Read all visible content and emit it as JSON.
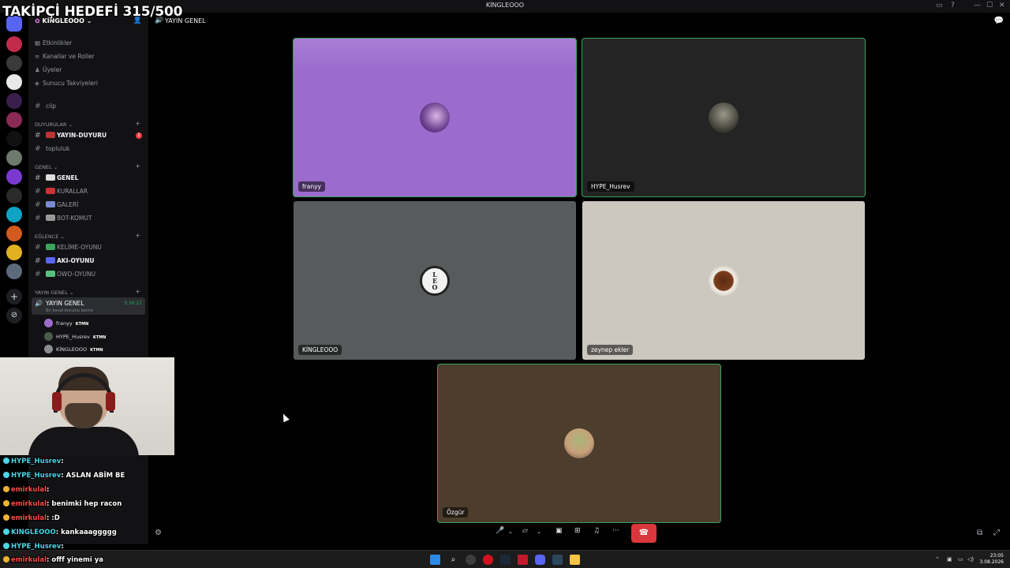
{
  "overlay": {
    "follower_goal": "TAKİPÇİ HEDEFİ 315/500"
  },
  "window": {
    "title": "KİNGLEOOO"
  },
  "server": {
    "name": "KİNGLEOOO"
  },
  "sidebar": {
    "menu": [
      {
        "label": "Etkinlikler",
        "icon": "calendar-icon"
      },
      {
        "label": "Kanallar ve Roller",
        "icon": "channels-icon"
      },
      {
        "label": "Üyeler",
        "icon": "members-icon"
      },
      {
        "label": "Sunucu Takviyeleri",
        "icon": "boost-icon"
      }
    ],
    "top_channel": "clip",
    "categories": [
      {
        "name": "DUYURULAR",
        "channels": [
          {
            "name": "YAYIN-DUYURU",
            "bold": true,
            "badge": "1"
          },
          {
            "name": "topluluk",
            "bold": false
          }
        ]
      },
      {
        "name": "GENEL",
        "channels": [
          {
            "name": "GENEL",
            "bold": true
          },
          {
            "name": "KURALLAR",
            "bold": false
          },
          {
            "name": "GALERİ",
            "bold": false
          },
          {
            "name": "BOT-KOMUT",
            "bold": false
          }
        ]
      },
      {
        "name": "EĞLENCE",
        "channels": [
          {
            "name": "KELİME-OYUNU",
            "bold": false
          },
          {
            "name": "AKI-OYUNU",
            "bold": true
          },
          {
            "name": "OWO-OYUNU",
            "bold": false
          }
        ]
      },
      {
        "name": "YAYIN GENEL",
        "channels": []
      }
    ],
    "voice_channel": {
      "name": "YAYIN GENEL",
      "elapsed": "3:36:22",
      "status": "Bir kanal durumu belirle",
      "users": [
        {
          "name": "franyy",
          "tag": "KTMN"
        },
        {
          "name": "HYPE_Husrev",
          "tag": "KTMN"
        },
        {
          "name": "KİNGLEOOO",
          "tag": "KTMN"
        }
      ]
    }
  },
  "chat": [
    {
      "user": "HYPE_Husrev",
      "message": "",
      "user_color": "cyan"
    },
    {
      "user": "HYPE_Husrev",
      "message": "ASLAN ABİM BE",
      "user_color": "cyan"
    },
    {
      "user": "emirkulal",
      "message": "",
      "user_color": "red"
    },
    {
      "user": "emirkulal",
      "message": "benimki hep racon",
      "user_color": "red"
    },
    {
      "user": "emirkulal",
      "message": ":D",
      "user_color": "red"
    },
    {
      "user": "KINGLEOOO",
      "message": "kankaaaggggg",
      "user_color": "cyan"
    },
    {
      "user": "HYPE_Husrev",
      "message": "",
      "user_color": "cyan"
    },
    {
      "user": "emirkulal",
      "message": "offf yinemi ya",
      "user_color": "red"
    }
  ],
  "header": {
    "channel": "YAYIN GENEL"
  },
  "tiles": [
    {
      "name": "franyy",
      "bg": "#9b6ccd",
      "speaking": true
    },
    {
      "name": "HYPE_Husrev",
      "bg": "#242424",
      "speaking": true
    },
    {
      "name": "KİNGLEOOO",
      "bg": "#585b5b",
      "speaking": false
    },
    {
      "name": "zeynep ekler",
      "bg": "#ccc8c0",
      "speaking": false
    },
    {
      "name": "Özgür",
      "bg": "#4c3d2c",
      "speaking": true
    }
  ],
  "controls": {
    "mic": "microphone-icon",
    "camera": "camera-off-icon",
    "share": "screen-share-icon",
    "activities": "activities-icon",
    "soundboard": "soundboard-icon",
    "more": "more-icon",
    "leave": "hang-up-icon"
  },
  "taskbar": {
    "time": "23:05",
    "date": "3.08.2026"
  }
}
